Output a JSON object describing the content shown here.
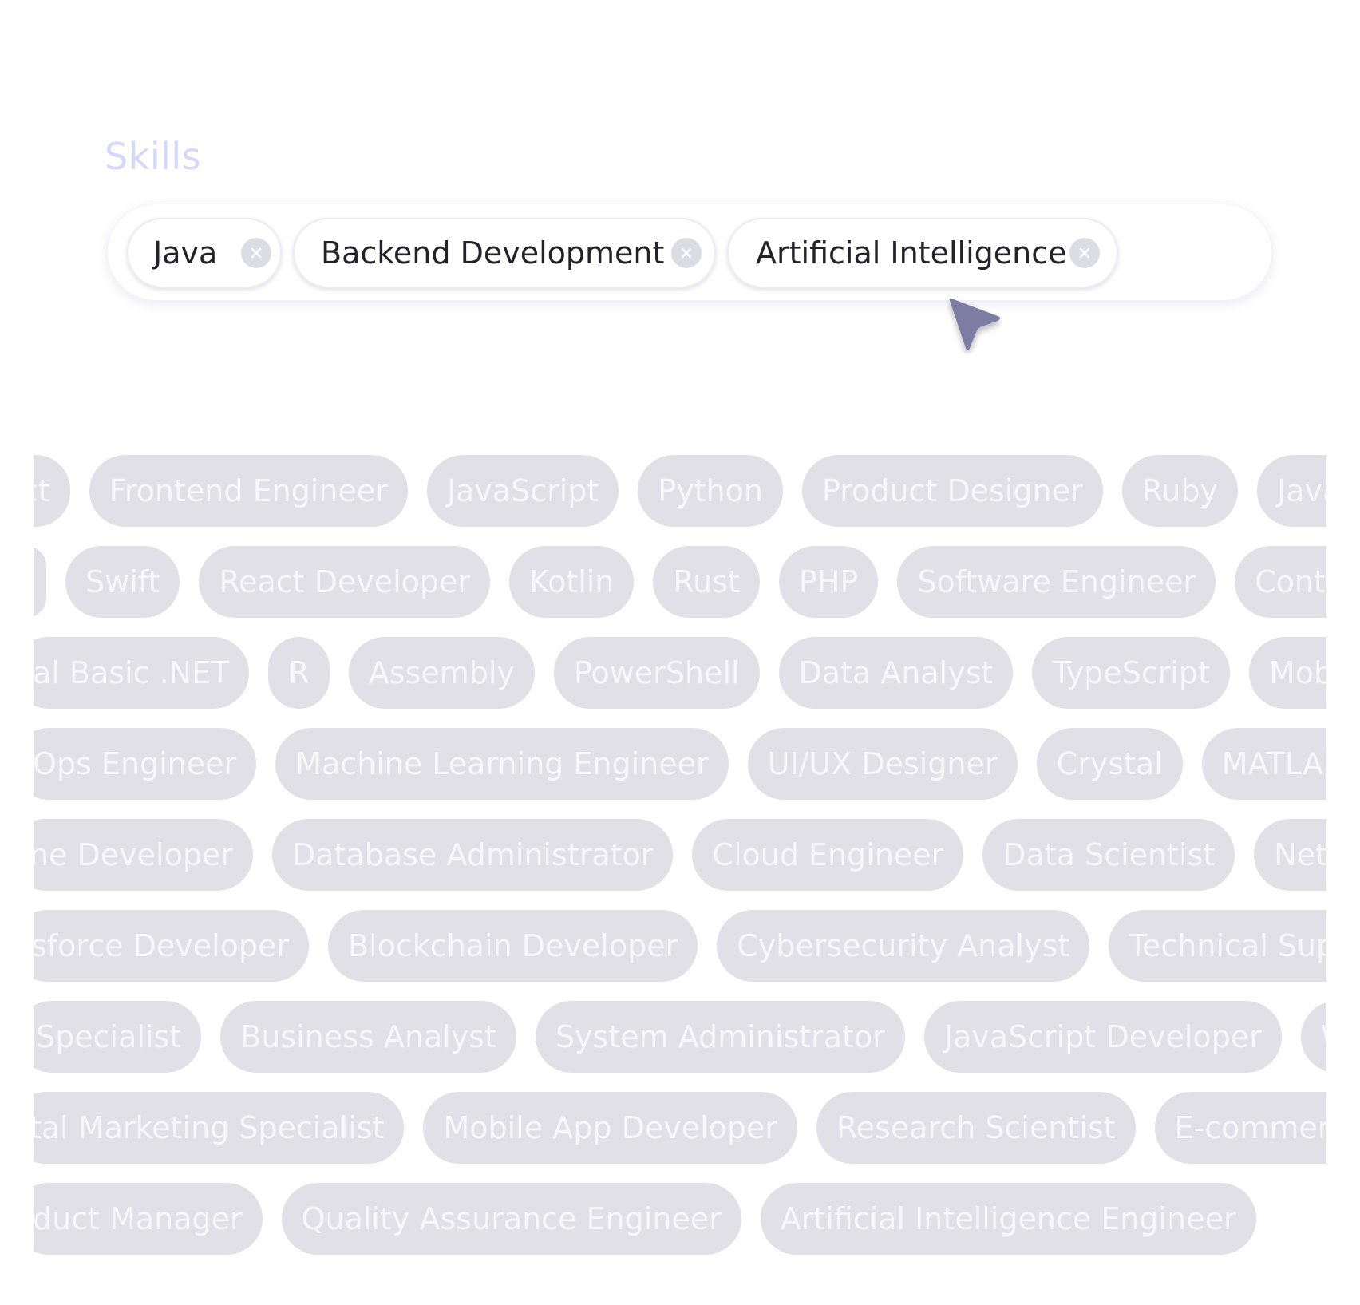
{
  "skills": {
    "label": "Skills",
    "selected": [
      {
        "label": "Java",
        "remove_icon": "close-icon"
      },
      {
        "label": "Backend Development",
        "remove_icon": "close-icon"
      },
      {
        "label": "Artificial Intelligence",
        "remove_icon": "close-icon"
      }
    ]
  },
  "colors": {
    "label_text": "#d6d8fb",
    "chip_text": "#222228",
    "suggestion_bg": "#e1e0e6",
    "suggestion_text": "#f7f7fa",
    "cursor": "#7d7ba3"
  },
  "suggestions": {
    "rows": [
      [
        "ct",
        "Frontend Engineer",
        "JavaScript",
        "Python",
        "Product Designer",
        "Ruby",
        "Java"
      ],
      [
        "",
        "Swift",
        "React Developer",
        "Kotlin",
        "Rust",
        "PHP",
        "Software Engineer",
        "Conten"
      ],
      [
        "al Basic .NET",
        "R",
        "Assembly",
        "PowerShell",
        "Data Analyst",
        "TypeScript",
        "Mobile"
      ],
      [
        "Ops Engineer",
        "Machine Learning Engineer",
        "UI/UX Designer",
        "Crystal",
        "MATLAB"
      ],
      [
        "ne Developer",
        "Database Administrator",
        "Cloud Engineer",
        "Data Scientist",
        "Networ"
      ],
      [
        "sforce Developer",
        "Blockchain Developer",
        "Cybersecurity Analyst",
        "Technical Suppor"
      ],
      [
        "Specialist",
        "Business Analyst",
        "System Administrator",
        "JavaScript Developer",
        "Web"
      ],
      [
        "tal Marketing Specialist",
        "Mobile App Developer",
        "Research Scientist",
        "E-commerce S"
      ],
      [
        "duct Manager",
        "Quality Assurance Engineer",
        "Artificial Intelligence Engineer"
      ]
    ]
  }
}
